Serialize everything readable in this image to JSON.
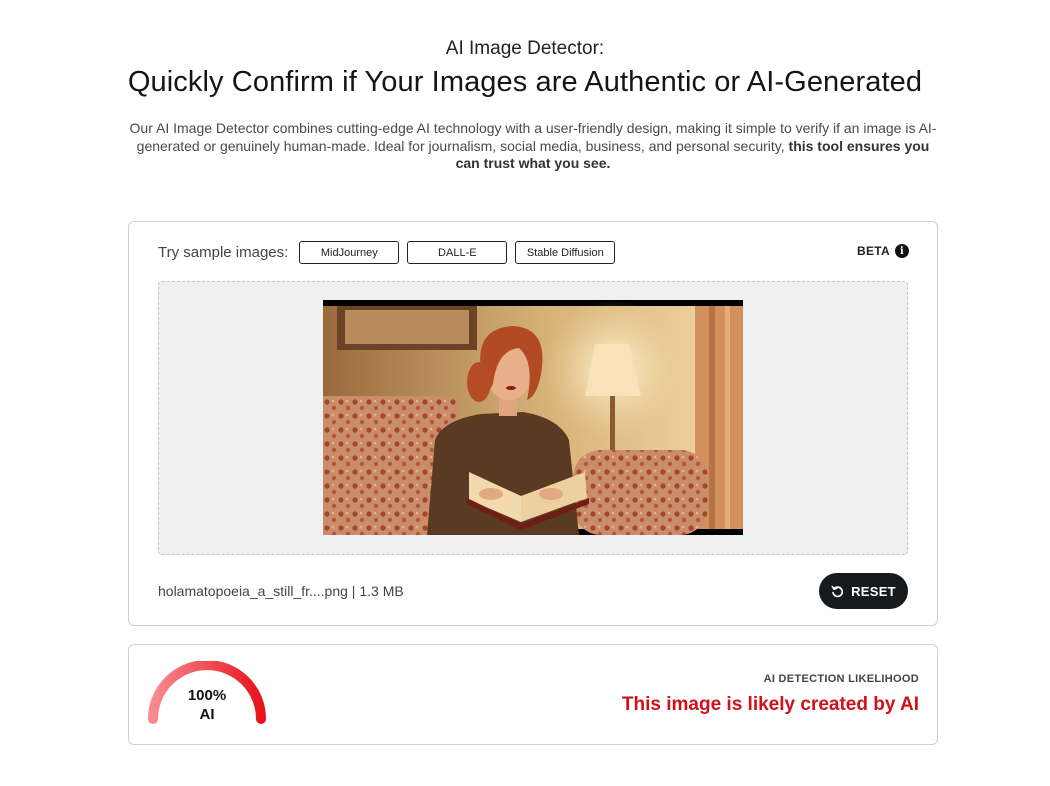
{
  "hero": {
    "eyebrow": "AI Image Detector:",
    "title": "Quickly Confirm if Your Images are Authentic or AI-Generated",
    "description": "Our AI Image Detector combines cutting-edge AI technology with a user-friendly design, making it simple to verify if an image is AI-generated or genuinely human-made. Ideal for journalism, social media, business, and personal security, ",
    "description_bold": "this tool ensures you can trust what you see."
  },
  "samples": {
    "label": "Try sample images:",
    "options": [
      "MidJourney",
      "DALL-E",
      "Stable Diffusion"
    ]
  },
  "beta": {
    "label": "BETA",
    "icon": "info-icon"
  },
  "upload": {
    "file_name": "holamatopoeia_a_still_fr....png",
    "file_size": "1.3 MB",
    "separator": " | ",
    "reset_label": "RESET",
    "reset_icon": "reset-icon",
    "preview_description_icon": "uploaded-image"
  },
  "result": {
    "percentage": "100%",
    "verdict_class": "AI",
    "likelihood_value": 1.0,
    "likelihood_label": "AI DETECTION LIKELIHOOD",
    "verdict": "This image is likely created by AI",
    "colors": {
      "gauge_start": "#f88a8f",
      "gauge_end": "#e8131c",
      "verdict": "#d0101b"
    }
  }
}
